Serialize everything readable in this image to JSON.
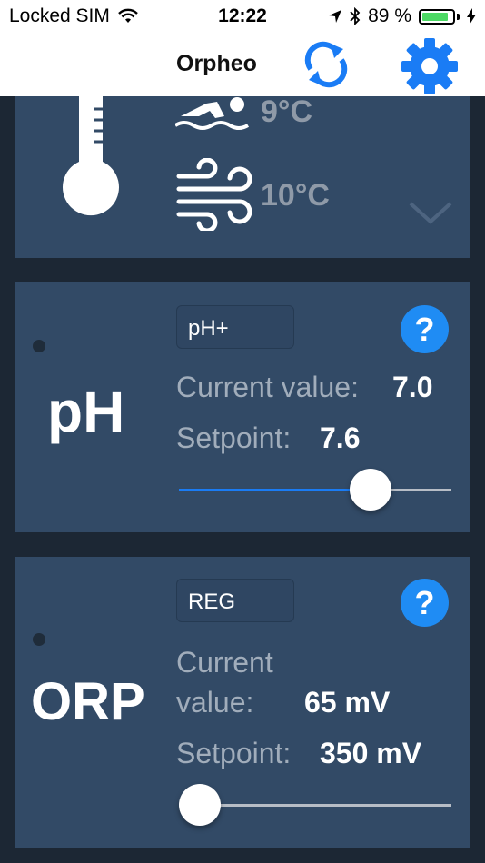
{
  "status_bar": {
    "carrier": "Locked SIM",
    "time": "12:22",
    "battery_percent": "89 %",
    "battery_level": 0.89
  },
  "nav": {
    "title": "Orpheo",
    "refresh_icon": "refresh-icon",
    "settings_icon": "gear-icon",
    "accent_color": "#1a7cf5"
  },
  "temperature": {
    "water": "9°C",
    "air": "10°C"
  },
  "ph": {
    "label": "pH",
    "mode": "pH+",
    "current_label": "Current value:",
    "current_value": "7.0",
    "setpoint_label": "Setpoint:",
    "setpoint_value": "7.6",
    "slider_level": 0.74
  },
  "orp": {
    "label": "ORP",
    "mode": "REG",
    "current_label_line1": "Current",
    "current_label_line2": "value:",
    "current_value": "65 mV",
    "setpoint_label": "Setpoint:",
    "setpoint_value": "350 mV",
    "slider_level": 0.0
  },
  "colors": {
    "card": "#324a66",
    "background": "#1c2734",
    "slider_active": "#1a7cf5",
    "help_button": "#1f8cf4"
  }
}
